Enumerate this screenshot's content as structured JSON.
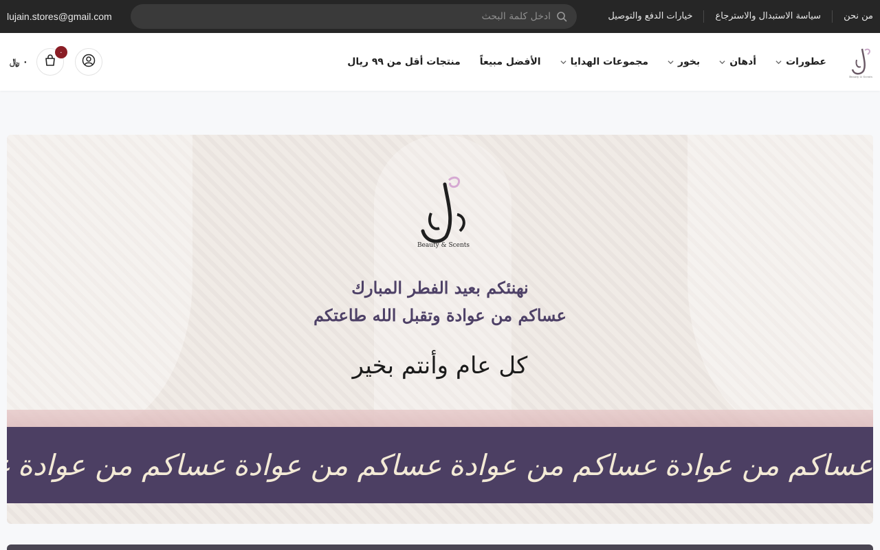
{
  "topbar": {
    "email": "lujain.stores@gmail.com",
    "search_placeholder": "ادخل كلمة البحث",
    "links": [
      "من نحن",
      "سياسة الاستبدال والاسترجاع",
      "خيارات الدفع والتوصيل"
    ]
  },
  "header": {
    "nav": [
      {
        "label": "عطورات",
        "dropdown": true
      },
      {
        "label": "أدهان",
        "dropdown": true
      },
      {
        "label": "بخور",
        "dropdown": true
      },
      {
        "label": "مجموعات الهدايا",
        "dropdown": true
      },
      {
        "label": "الأفضل مبيعاً",
        "dropdown": false
      },
      {
        "label": "منتجات أقل من ٩٩ ريال",
        "dropdown": false
      }
    ],
    "cart_count": "٠",
    "cart_total": "٠ ﷼",
    "icons": {
      "account": "user-icon",
      "cart": "shopping-bag-icon",
      "search": "search-icon"
    }
  },
  "banner": {
    "logo_sub": "Beauty & Scents",
    "line1": "نهنئكم بعيد الفطر المبارك",
    "line2": "عساكم من عوادة وتقبل الله طاعتكم",
    "line3": "كل عام وأنتم بخير",
    "band_text": "عساكم من عوادة",
    "band_color": "#4c3f63"
  },
  "colors": {
    "topbar_bg": "#262626",
    "accent": "#8a1d25",
    "text_purple": "#4e4167"
  }
}
